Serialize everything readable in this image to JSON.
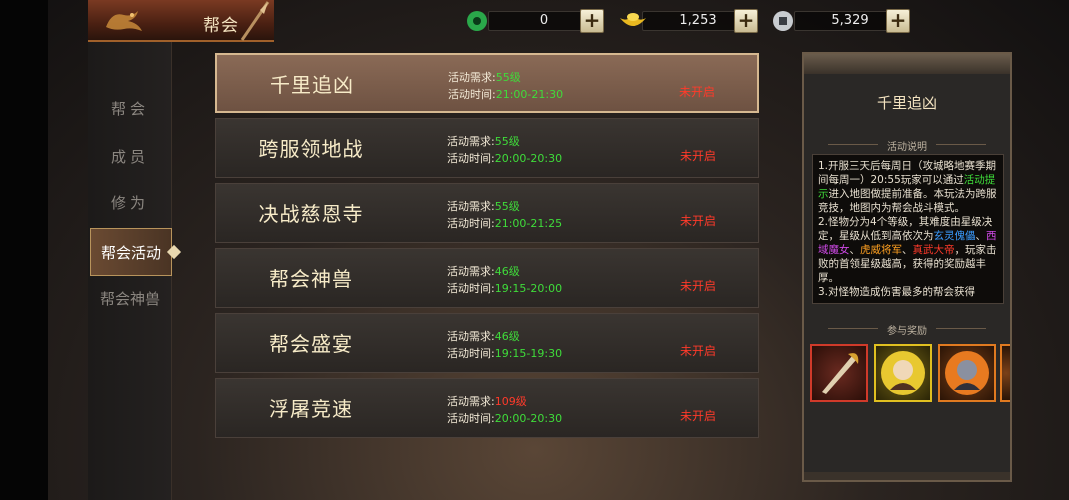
{
  "header": {
    "title": "帮会",
    "currencies": [
      {
        "icon": "jade-icon",
        "value": "0"
      },
      {
        "icon": "gold-ingot-icon",
        "value": "1,253"
      },
      {
        "icon": "silver-coin-icon",
        "value": "5,329"
      }
    ]
  },
  "sidebar": {
    "items": [
      {
        "label": "帮会"
      },
      {
        "label": "成员"
      },
      {
        "label": "修为"
      },
      {
        "label": "帮会活动"
      },
      {
        "label": "帮会神兽"
      }
    ]
  },
  "events": [
    {
      "name": "千里追凶",
      "req_label": "活动需求:",
      "req_level": "55级",
      "time_label": "活动时间:",
      "time": "21:00-21:30",
      "status": "未开启"
    },
    {
      "name": "跨服领地战",
      "req_label": "活动需求:",
      "req_level": "55级",
      "time_label": "活动时间:",
      "time": "20:00-20:30",
      "status": "未开启"
    },
    {
      "name": "决战慈恩寺",
      "req_label": "活动需求:",
      "req_level": "55级",
      "time_label": "活动时间:",
      "time": "21:00-21:25",
      "status": "未开启"
    },
    {
      "name": "帮会神兽",
      "req_label": "活动需求:",
      "req_level": "46级",
      "time_label": "活动时间:",
      "time": "19:15-20:00",
      "status": "未开启"
    },
    {
      "name": "帮会盛宴",
      "req_label": "活动需求:",
      "req_level": "46级",
      "time_label": "活动时间:",
      "time": "19:15-19:30",
      "status": "未开启"
    },
    {
      "name": "浮屠竞速",
      "req_label": "活动需求:",
      "req_level": "109级",
      "time_label": "活动时间:",
      "time": "20:00-20:30",
      "status": "未开启"
    }
  ],
  "detail": {
    "title": "千里追凶",
    "desc_label": "活动说明",
    "desc": {
      "p1a": "1.开服三天后每周日（攻城略地赛季期间每周一）20:55玩家可以通过",
      "p1link": "活动提示",
      "p1b": "进入地图做提前准备。本玩法为跨服竞技，地图内为帮会战斗模式。",
      "p2a": "2.怪物分为4个等级，其难度由星级决定，星级从低到高依次为",
      "m1": "玄灵傀儡",
      "m2": "西域魔女",
      "m3": "虎威将军",
      "m4": "真武大帝",
      "p2b": "，玩家击败的首领星级越高，获得的奖励越丰厚。",
      "p3": "3.对怪物造成伤害最多的帮会获得"
    },
    "reward_label": "参与奖励",
    "rewards": [
      {
        "icon": "weapon-icon",
        "rarity": "red"
      },
      {
        "icon": "portrait-icon",
        "rarity": "yellow"
      },
      {
        "icon": "portrait-icon",
        "rarity": "orange"
      }
    ]
  },
  "colors": {
    "level_ok": "#3fdc3a",
    "level_high": "#ff3a2a",
    "status": "#ff3a2a"
  }
}
